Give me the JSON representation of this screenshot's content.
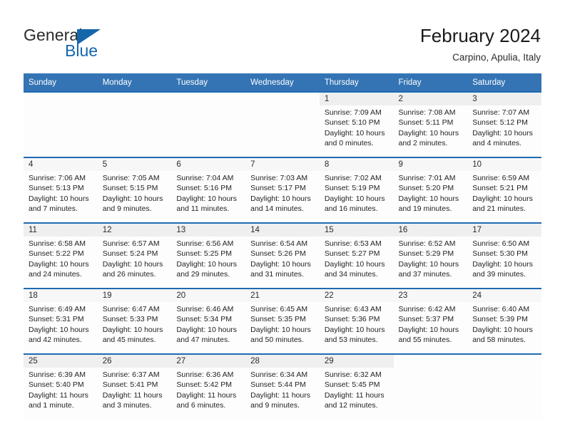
{
  "brand": {
    "name_part1": "General",
    "name_part2": "Blue",
    "triangle_color": "#1566ab"
  },
  "header": {
    "title": "February 2024",
    "subtitle": "Carpino, Apulia, Italy"
  },
  "theme": {
    "header_row_bg": "#3474b4",
    "week_separator": "#1e6bb2",
    "daynum_band_bg": "#efefef"
  },
  "weekday_headers": [
    "Sunday",
    "Monday",
    "Tuesday",
    "Wednesday",
    "Thursday",
    "Friday",
    "Saturday"
  ],
  "weeks": [
    {
      "days": [
        {
          "num": "",
          "sunrise": "",
          "sunset": "",
          "daylight1": "",
          "daylight2": "",
          "empty": true
        },
        {
          "num": "",
          "sunrise": "",
          "sunset": "",
          "daylight1": "",
          "daylight2": "",
          "empty": true
        },
        {
          "num": "",
          "sunrise": "",
          "sunset": "",
          "daylight1": "",
          "daylight2": "",
          "empty": true
        },
        {
          "num": "",
          "sunrise": "",
          "sunset": "",
          "daylight1": "",
          "daylight2": "",
          "empty": true
        },
        {
          "num": "1",
          "sunrise": "Sunrise: 7:09 AM",
          "sunset": "Sunset: 5:10 PM",
          "daylight1": "Daylight: 10 hours",
          "daylight2": "and 0 minutes.",
          "empty": false
        },
        {
          "num": "2",
          "sunrise": "Sunrise: 7:08 AM",
          "sunset": "Sunset: 5:11 PM",
          "daylight1": "Daylight: 10 hours",
          "daylight2": "and 2 minutes.",
          "empty": false
        },
        {
          "num": "3",
          "sunrise": "Sunrise: 7:07 AM",
          "sunset": "Sunset: 5:12 PM",
          "daylight1": "Daylight: 10 hours",
          "daylight2": "and 4 minutes.",
          "empty": false
        }
      ]
    },
    {
      "days": [
        {
          "num": "4",
          "sunrise": "Sunrise: 7:06 AM",
          "sunset": "Sunset: 5:13 PM",
          "daylight1": "Daylight: 10 hours",
          "daylight2": "and 7 minutes.",
          "empty": false
        },
        {
          "num": "5",
          "sunrise": "Sunrise: 7:05 AM",
          "sunset": "Sunset: 5:15 PM",
          "daylight1": "Daylight: 10 hours",
          "daylight2": "and 9 minutes.",
          "empty": false
        },
        {
          "num": "6",
          "sunrise": "Sunrise: 7:04 AM",
          "sunset": "Sunset: 5:16 PM",
          "daylight1": "Daylight: 10 hours",
          "daylight2": "and 11 minutes.",
          "empty": false
        },
        {
          "num": "7",
          "sunrise": "Sunrise: 7:03 AM",
          "sunset": "Sunset: 5:17 PM",
          "daylight1": "Daylight: 10 hours",
          "daylight2": "and 14 minutes.",
          "empty": false
        },
        {
          "num": "8",
          "sunrise": "Sunrise: 7:02 AM",
          "sunset": "Sunset: 5:19 PM",
          "daylight1": "Daylight: 10 hours",
          "daylight2": "and 16 minutes.",
          "empty": false
        },
        {
          "num": "9",
          "sunrise": "Sunrise: 7:01 AM",
          "sunset": "Sunset: 5:20 PM",
          "daylight1": "Daylight: 10 hours",
          "daylight2": "and 19 minutes.",
          "empty": false
        },
        {
          "num": "10",
          "sunrise": "Sunrise: 6:59 AM",
          "sunset": "Sunset: 5:21 PM",
          "daylight1": "Daylight: 10 hours",
          "daylight2": "and 21 minutes.",
          "empty": false
        }
      ]
    },
    {
      "days": [
        {
          "num": "11",
          "sunrise": "Sunrise: 6:58 AM",
          "sunset": "Sunset: 5:22 PM",
          "daylight1": "Daylight: 10 hours",
          "daylight2": "and 24 minutes.",
          "empty": false
        },
        {
          "num": "12",
          "sunrise": "Sunrise: 6:57 AM",
          "sunset": "Sunset: 5:24 PM",
          "daylight1": "Daylight: 10 hours",
          "daylight2": "and 26 minutes.",
          "empty": false
        },
        {
          "num": "13",
          "sunrise": "Sunrise: 6:56 AM",
          "sunset": "Sunset: 5:25 PM",
          "daylight1": "Daylight: 10 hours",
          "daylight2": "and 29 minutes.",
          "empty": false
        },
        {
          "num": "14",
          "sunrise": "Sunrise: 6:54 AM",
          "sunset": "Sunset: 5:26 PM",
          "daylight1": "Daylight: 10 hours",
          "daylight2": "and 31 minutes.",
          "empty": false
        },
        {
          "num": "15",
          "sunrise": "Sunrise: 6:53 AM",
          "sunset": "Sunset: 5:27 PM",
          "daylight1": "Daylight: 10 hours",
          "daylight2": "and 34 minutes.",
          "empty": false
        },
        {
          "num": "16",
          "sunrise": "Sunrise: 6:52 AM",
          "sunset": "Sunset: 5:29 PM",
          "daylight1": "Daylight: 10 hours",
          "daylight2": "and 37 minutes.",
          "empty": false
        },
        {
          "num": "17",
          "sunrise": "Sunrise: 6:50 AM",
          "sunset": "Sunset: 5:30 PM",
          "daylight1": "Daylight: 10 hours",
          "daylight2": "and 39 minutes.",
          "empty": false
        }
      ]
    },
    {
      "days": [
        {
          "num": "18",
          "sunrise": "Sunrise: 6:49 AM",
          "sunset": "Sunset: 5:31 PM",
          "daylight1": "Daylight: 10 hours",
          "daylight2": "and 42 minutes.",
          "empty": false
        },
        {
          "num": "19",
          "sunrise": "Sunrise: 6:47 AM",
          "sunset": "Sunset: 5:33 PM",
          "daylight1": "Daylight: 10 hours",
          "daylight2": "and 45 minutes.",
          "empty": false
        },
        {
          "num": "20",
          "sunrise": "Sunrise: 6:46 AM",
          "sunset": "Sunset: 5:34 PM",
          "daylight1": "Daylight: 10 hours",
          "daylight2": "and 47 minutes.",
          "empty": false
        },
        {
          "num": "21",
          "sunrise": "Sunrise: 6:45 AM",
          "sunset": "Sunset: 5:35 PM",
          "daylight1": "Daylight: 10 hours",
          "daylight2": "and 50 minutes.",
          "empty": false
        },
        {
          "num": "22",
          "sunrise": "Sunrise: 6:43 AM",
          "sunset": "Sunset: 5:36 PM",
          "daylight1": "Daylight: 10 hours",
          "daylight2": "and 53 minutes.",
          "empty": false
        },
        {
          "num": "23",
          "sunrise": "Sunrise: 6:42 AM",
          "sunset": "Sunset: 5:37 PM",
          "daylight1": "Daylight: 10 hours",
          "daylight2": "and 55 minutes.",
          "empty": false
        },
        {
          "num": "24",
          "sunrise": "Sunrise: 6:40 AM",
          "sunset": "Sunset: 5:39 PM",
          "daylight1": "Daylight: 10 hours",
          "daylight2": "and 58 minutes.",
          "empty": false
        }
      ]
    },
    {
      "days": [
        {
          "num": "25",
          "sunrise": "Sunrise: 6:39 AM",
          "sunset": "Sunset: 5:40 PM",
          "daylight1": "Daylight: 11 hours",
          "daylight2": "and 1 minute.",
          "empty": false
        },
        {
          "num": "26",
          "sunrise": "Sunrise: 6:37 AM",
          "sunset": "Sunset: 5:41 PM",
          "daylight1": "Daylight: 11 hours",
          "daylight2": "and 3 minutes.",
          "empty": false
        },
        {
          "num": "27",
          "sunrise": "Sunrise: 6:36 AM",
          "sunset": "Sunset: 5:42 PM",
          "daylight1": "Daylight: 11 hours",
          "daylight2": "and 6 minutes.",
          "empty": false
        },
        {
          "num": "28",
          "sunrise": "Sunrise: 6:34 AM",
          "sunset": "Sunset: 5:44 PM",
          "daylight1": "Daylight: 11 hours",
          "daylight2": "and 9 minutes.",
          "empty": false
        },
        {
          "num": "29",
          "sunrise": "Sunrise: 6:32 AM",
          "sunset": "Sunset: 5:45 PM",
          "daylight1": "Daylight: 11 hours",
          "daylight2": "and 12 minutes.",
          "empty": false
        },
        {
          "num": "",
          "sunrise": "",
          "sunset": "",
          "daylight1": "",
          "daylight2": "",
          "empty": true
        },
        {
          "num": "",
          "sunrise": "",
          "sunset": "",
          "daylight1": "",
          "daylight2": "",
          "empty": true
        }
      ]
    }
  ]
}
